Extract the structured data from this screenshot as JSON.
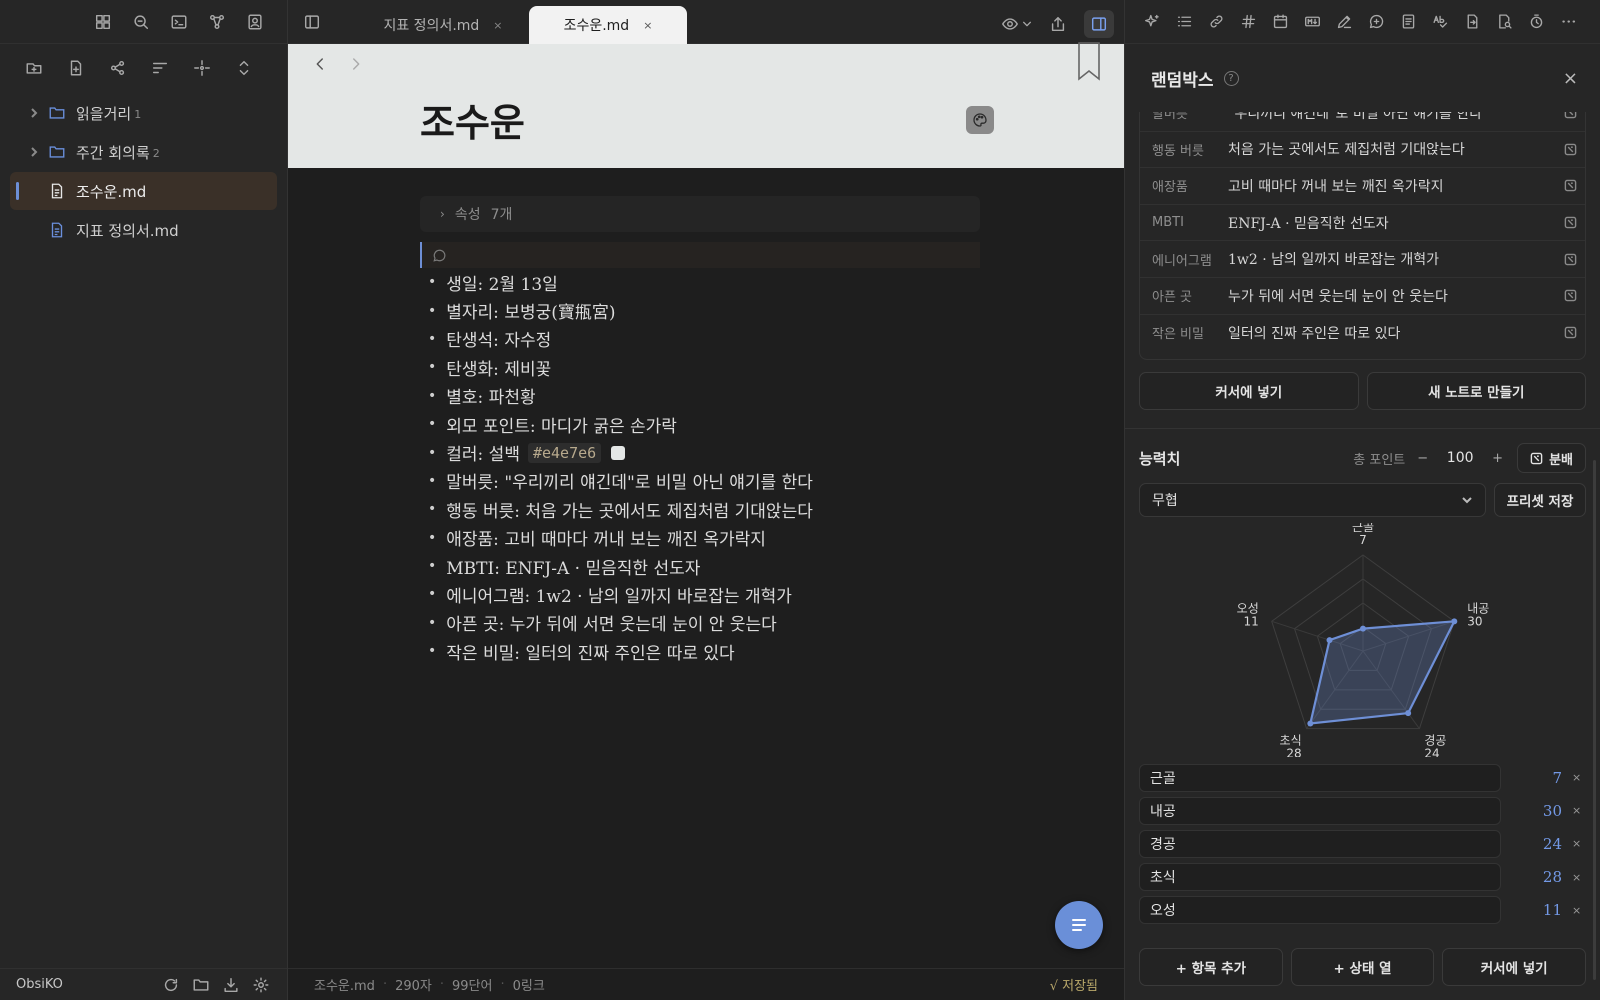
{
  "left_sidebar": {
    "top_icons": [
      "dashboard-icon",
      "search-icon",
      "terminal-icon",
      "graph-icon",
      "contact-icon"
    ],
    "file_tools": [
      "new-folder-icon",
      "new-note-icon",
      "graph-icon",
      "sort-icon",
      "focus-icon",
      "expand-icon"
    ],
    "tree": [
      {
        "type": "folder",
        "label": "읽을거리",
        "count": "1"
      },
      {
        "type": "folder",
        "label": "주간 회의록",
        "count": "2"
      },
      {
        "type": "file",
        "label": "조수운.md",
        "active": true
      },
      {
        "type": "file",
        "label": "지표 정의서.md"
      }
    ],
    "vault_name": "ObsiKO"
  },
  "tabs": [
    {
      "label": "지표 정의서.md",
      "close": "×"
    },
    {
      "label": "조수운.md",
      "close": "×"
    }
  ],
  "note": {
    "title": "조수운",
    "properties_label": "속성",
    "properties_count": "7개",
    "color_label": "컬러: 설백",
    "color_hex": "#e4e7e6",
    "bullets_before": [
      "생일: 2월 13일",
      "별자리: 보병궁(寶甁宮)",
      "탄생석: 자수정",
      "탄생화: 제비꽃",
      "별호: 파천황",
      "외모 포인트: 마디가 굵은 손가락"
    ],
    "bullets_after": [
      "말버릇: \"우리끼리 얘긴데\"로 비밀 아닌 얘기를 한다",
      "행동 버릇: 처음 가는 곳에서도 제집처럼 기대앉는다",
      "애장품: 고비 때마다 꺼내 보는 깨진 옥가락지",
      "MBTI: ENFJ-A · 믿음직한 선도자",
      "에니어그램: 1w2 · 남의 일까지 바로잡는 개혁가",
      "아픈 곳: 누가 뒤에 서면 웃는데 눈이 안 웃는다",
      "작은 비밀: 일터의 진짜 주인은 따로 있다"
    ]
  },
  "status_bar": {
    "file": "조수운.md",
    "chars": "290자",
    "words": "99단어",
    "links": "0링크",
    "saved": "√ 저장됨"
  },
  "right_panel": {
    "title": "랜덤박스",
    "help": "?",
    "close": "×",
    "random_rows": [
      {
        "k": "말버릇",
        "v": "\"우리끼리 얘긴데\"로 비밀 아닌 얘기를 한다"
      },
      {
        "k": "행동 버릇",
        "v": "처음 가는 곳에서도 제집처럼 기대앉는다"
      },
      {
        "k": "애장품",
        "v": "고비 때마다 꺼내 보는 깨진 옥가락지"
      },
      {
        "k": "MBTI",
        "v": "ENFJ-A · 믿음직한 선도자"
      },
      {
        "k": "에니어그램",
        "v": "1w2 · 남의 일까지 바로잡는 개혁가"
      },
      {
        "k": "아픈 곳",
        "v": "누가 뒤에 서면 웃는데 눈이 안 웃는다"
      },
      {
        "k": "작은 비밀",
        "v": "일터의 진짜 주인은 따로 있다"
      }
    ],
    "insert_at_cursor": "커서에 넣기",
    "new_note": "새 노트로 만들기",
    "stats": {
      "title": "능력치",
      "total_label": "총 포인트",
      "minus": "−",
      "plus": "+",
      "total": "100",
      "split_label": "분배",
      "preset_selected": "무협",
      "save_preset": "프리셋 저장",
      "items": [
        {
          "name": "근골",
          "value": 7
        },
        {
          "name": "내공",
          "value": 30
        },
        {
          "name": "경공",
          "value": 24
        },
        {
          "name": "초식",
          "value": 28
        },
        {
          "name": "오성",
          "value": 11
        }
      ],
      "radar_max": 30,
      "accent": "#6e8fd6"
    },
    "bottom": {
      "add_item": "+ 항목 추가",
      "add_status": "+ 상태 열",
      "insert": "커서에 넣기"
    }
  },
  "colors": {
    "accent": "#6e8fd6",
    "header_band": "#e4e7e6",
    "saved": "#b9a86a"
  }
}
